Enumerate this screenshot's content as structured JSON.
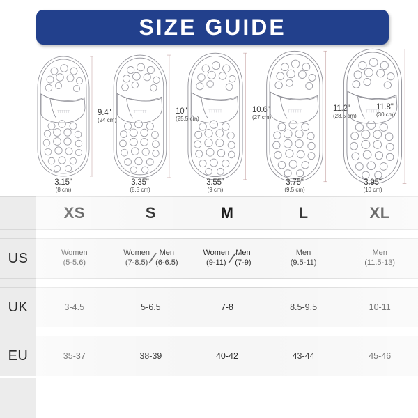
{
  "banner": {
    "title": "SIZE GUIDE",
    "background_color": "#22408c",
    "text_color": "#ffffff"
  },
  "product": {
    "type": "massage slipper / sandal illustration",
    "count": 5
  },
  "shoes": [
    {
      "size": "XS",
      "length_in": "9.4''",
      "length_cm": "(24 cm)",
      "width_in": "3.15''",
      "width_cm": "(8 cm)"
    },
    {
      "size": "S",
      "length_in": "10''",
      "length_cm": "(25.5 cm)",
      "width_in": "3.35''",
      "width_cm": "(8.5 cm)"
    },
    {
      "size": "M",
      "length_in": "10.6''",
      "length_cm": "(27 cm)",
      "width_in": "3.55''",
      "width_cm": "(9 cm)"
    },
    {
      "size": "L",
      "length_in": "11.2''",
      "length_cm": "(28.5 cm)",
      "width_in": "3.75''",
      "width_cm": "(9.5 cm)"
    },
    {
      "size": "XL",
      "length_in": "11.8''",
      "length_cm": "(30 cm)",
      "width_in": "3.95''",
      "width_cm": "(10 cm)"
    }
  ],
  "table": {
    "corner_label": "",
    "size_headers": [
      "XS",
      "S",
      "M",
      "L",
      "XL"
    ],
    "rows": [
      {
        "label": "US",
        "type": "composite",
        "cells": [
          {
            "left_title": "Women",
            "left_value": "(5-5.6)",
            "has_slash": false,
            "right_title": "",
            "right_value": ""
          },
          {
            "left_title": "Women",
            "left_value": "(7-8.5)",
            "has_slash": true,
            "right_title": "Men",
            "right_value": "(6-6.5)"
          },
          {
            "left_title": "Women",
            "left_value": "(9-11)",
            "has_slash": true,
            "right_title": "Men",
            "right_value": "(7-9)"
          },
          {
            "left_title": "Men",
            "left_value": "(9.5-11)",
            "has_slash": false,
            "right_title": "",
            "right_value": ""
          },
          {
            "left_title": "Men",
            "left_value": "(11.5-13)",
            "has_slash": false,
            "right_title": "",
            "right_value": ""
          }
        ]
      },
      {
        "label": "UK",
        "type": "simple",
        "cells": [
          "3-4.5",
          "5-6.5",
          "7-8",
          "8.5-9.5",
          "10-11"
        ]
      },
      {
        "label": "EU",
        "type": "simple",
        "cells": [
          "35-37",
          "38-39",
          "40-42",
          "43-44",
          "45-46"
        ]
      }
    ]
  },
  "colors": {
    "banner_blue": "#22408c",
    "row_label_bg": "#ececec",
    "cell_bg": "#f6f6f6",
    "border": "#d8d8d8",
    "text": "#2b2b2b"
  }
}
